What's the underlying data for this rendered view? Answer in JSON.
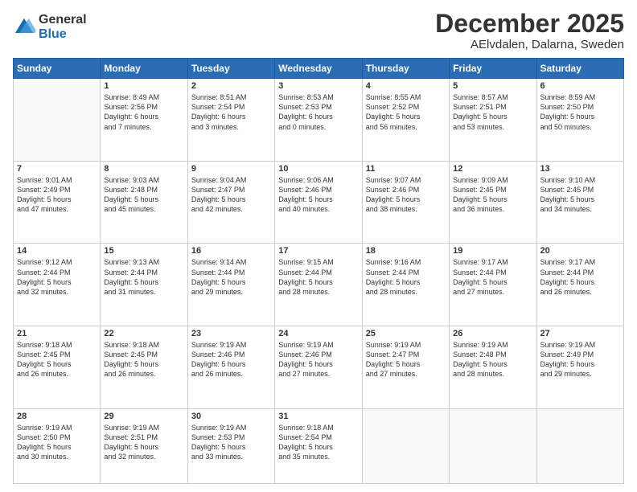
{
  "logo": {
    "general": "General",
    "blue": "Blue"
  },
  "title": "December 2025",
  "location": "AElvdalen, Dalarna, Sweden",
  "days_header": [
    "Sunday",
    "Monday",
    "Tuesday",
    "Wednesday",
    "Thursday",
    "Friday",
    "Saturday"
  ],
  "weeks": [
    [
      {
        "day": "",
        "info": ""
      },
      {
        "day": "1",
        "info": "Sunrise: 8:49 AM\nSunset: 2:56 PM\nDaylight: 6 hours\nand 7 minutes."
      },
      {
        "day": "2",
        "info": "Sunrise: 8:51 AM\nSunset: 2:54 PM\nDaylight: 6 hours\nand 3 minutes."
      },
      {
        "day": "3",
        "info": "Sunrise: 8:53 AM\nSunset: 2:53 PM\nDaylight: 6 hours\nand 0 minutes."
      },
      {
        "day": "4",
        "info": "Sunrise: 8:55 AM\nSunset: 2:52 PM\nDaylight: 5 hours\nand 56 minutes."
      },
      {
        "day": "5",
        "info": "Sunrise: 8:57 AM\nSunset: 2:51 PM\nDaylight: 5 hours\nand 53 minutes."
      },
      {
        "day": "6",
        "info": "Sunrise: 8:59 AM\nSunset: 2:50 PM\nDaylight: 5 hours\nand 50 minutes."
      }
    ],
    [
      {
        "day": "7",
        "info": "Sunrise: 9:01 AM\nSunset: 2:49 PM\nDaylight: 5 hours\nand 47 minutes."
      },
      {
        "day": "8",
        "info": "Sunrise: 9:03 AM\nSunset: 2:48 PM\nDaylight: 5 hours\nand 45 minutes."
      },
      {
        "day": "9",
        "info": "Sunrise: 9:04 AM\nSunset: 2:47 PM\nDaylight: 5 hours\nand 42 minutes."
      },
      {
        "day": "10",
        "info": "Sunrise: 9:06 AM\nSunset: 2:46 PM\nDaylight: 5 hours\nand 40 minutes."
      },
      {
        "day": "11",
        "info": "Sunrise: 9:07 AM\nSunset: 2:46 PM\nDaylight: 5 hours\nand 38 minutes."
      },
      {
        "day": "12",
        "info": "Sunrise: 9:09 AM\nSunset: 2:45 PM\nDaylight: 5 hours\nand 36 minutes."
      },
      {
        "day": "13",
        "info": "Sunrise: 9:10 AM\nSunset: 2:45 PM\nDaylight: 5 hours\nand 34 minutes."
      }
    ],
    [
      {
        "day": "14",
        "info": "Sunrise: 9:12 AM\nSunset: 2:44 PM\nDaylight: 5 hours\nand 32 minutes."
      },
      {
        "day": "15",
        "info": "Sunrise: 9:13 AM\nSunset: 2:44 PM\nDaylight: 5 hours\nand 31 minutes."
      },
      {
        "day": "16",
        "info": "Sunrise: 9:14 AM\nSunset: 2:44 PM\nDaylight: 5 hours\nand 29 minutes."
      },
      {
        "day": "17",
        "info": "Sunrise: 9:15 AM\nSunset: 2:44 PM\nDaylight: 5 hours\nand 28 minutes."
      },
      {
        "day": "18",
        "info": "Sunrise: 9:16 AM\nSunset: 2:44 PM\nDaylight: 5 hours\nand 28 minutes."
      },
      {
        "day": "19",
        "info": "Sunrise: 9:17 AM\nSunset: 2:44 PM\nDaylight: 5 hours\nand 27 minutes."
      },
      {
        "day": "20",
        "info": "Sunrise: 9:17 AM\nSunset: 2:44 PM\nDaylight: 5 hours\nand 26 minutes."
      }
    ],
    [
      {
        "day": "21",
        "info": "Sunrise: 9:18 AM\nSunset: 2:45 PM\nDaylight: 5 hours\nand 26 minutes."
      },
      {
        "day": "22",
        "info": "Sunrise: 9:18 AM\nSunset: 2:45 PM\nDaylight: 5 hours\nand 26 minutes."
      },
      {
        "day": "23",
        "info": "Sunrise: 9:19 AM\nSunset: 2:46 PM\nDaylight: 5 hours\nand 26 minutes."
      },
      {
        "day": "24",
        "info": "Sunrise: 9:19 AM\nSunset: 2:46 PM\nDaylight: 5 hours\nand 27 minutes."
      },
      {
        "day": "25",
        "info": "Sunrise: 9:19 AM\nSunset: 2:47 PM\nDaylight: 5 hours\nand 27 minutes."
      },
      {
        "day": "26",
        "info": "Sunrise: 9:19 AM\nSunset: 2:48 PM\nDaylight: 5 hours\nand 28 minutes."
      },
      {
        "day": "27",
        "info": "Sunrise: 9:19 AM\nSunset: 2:49 PM\nDaylight: 5 hours\nand 29 minutes."
      }
    ],
    [
      {
        "day": "28",
        "info": "Sunrise: 9:19 AM\nSunset: 2:50 PM\nDaylight: 5 hours\nand 30 minutes."
      },
      {
        "day": "29",
        "info": "Sunrise: 9:19 AM\nSunset: 2:51 PM\nDaylight: 5 hours\nand 32 minutes."
      },
      {
        "day": "30",
        "info": "Sunrise: 9:19 AM\nSunset: 2:53 PM\nDaylight: 5 hours\nand 33 minutes."
      },
      {
        "day": "31",
        "info": "Sunrise: 9:18 AM\nSunset: 2:54 PM\nDaylight: 5 hours\nand 35 minutes."
      },
      {
        "day": "",
        "info": ""
      },
      {
        "day": "",
        "info": ""
      },
      {
        "day": "",
        "info": ""
      }
    ]
  ]
}
